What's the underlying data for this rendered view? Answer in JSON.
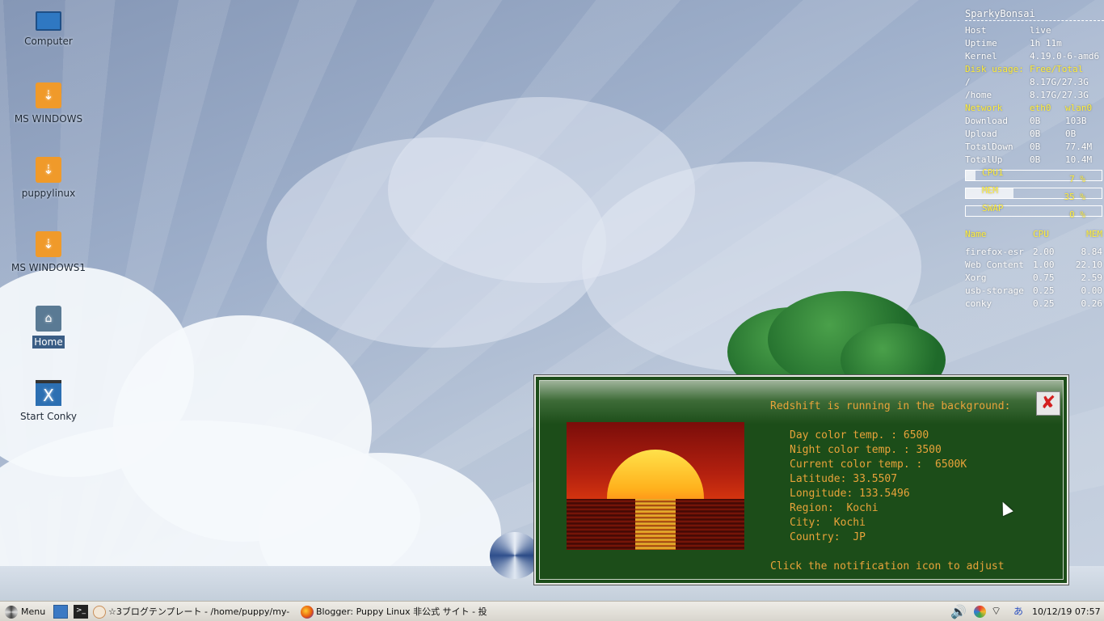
{
  "desktop": {
    "icons": [
      {
        "label": "Computer",
        "icon": "computer-icon"
      },
      {
        "label": "MS WINDOWS",
        "icon": "usb-drive-icon"
      },
      {
        "label": "puppylinux",
        "icon": "usb-drive-icon"
      },
      {
        "label": "MS WINDOWS1",
        "icon": "usb-drive-icon"
      },
      {
        "label": "Home",
        "icon": "home-folder-icon"
      },
      {
        "label": "Start Conky",
        "icon": "conky-icon"
      }
    ]
  },
  "conky": {
    "title": "SparkyBonsai",
    "sys": [
      {
        "k": "Host",
        "v": "live"
      },
      {
        "k": "Uptime",
        "v": "1h 11m"
      },
      {
        "k": "Kernel",
        "v": "4.19.0-6-amd6"
      }
    ],
    "disk_header": {
      "k": "Disk usage:",
      "v": "Free/Total"
    },
    "disk": [
      {
        "k": "/",
        "v": "8.17G/27.3G"
      },
      {
        "k": "/home",
        "v": "8.17G/27.3G"
      }
    ],
    "net_header": {
      "k": "Network",
      "a": "eth0",
      "b": "wlan0"
    },
    "net": [
      {
        "k": "Download",
        "a": "0B",
        "b": "103B"
      },
      {
        "k": "Upload",
        "a": "0B",
        "b": "0B"
      },
      {
        "k": "TotalDown",
        "a": "0B",
        "b": "77.4M"
      },
      {
        "k": "TotalUp",
        "a": "0B",
        "b": "10.4M"
      }
    ],
    "bars": [
      {
        "label": "CPU1",
        "value": "7  %",
        "fraction": 0.07
      },
      {
        "label": "MEM",
        "value": "35 %",
        "fraction": 0.35
      },
      {
        "label": "SWAP",
        "value": "0  %",
        "fraction": 0.0
      }
    ],
    "proc_header": {
      "name": "Name",
      "cpu": "CPU",
      "mem": "MEM"
    },
    "procs": [
      {
        "name": "firefox-esr",
        "cpu": "2.00",
        "mem": "8.84"
      },
      {
        "name": "Web Content",
        "cpu": "1.00",
        "mem": "22.10"
      },
      {
        "name": "Xorg",
        "cpu": "0.75",
        "mem": "2.59"
      },
      {
        "name": "usb-storage",
        "cpu": "0.25",
        "mem": "0.00"
      },
      {
        "name": "conky",
        "cpu": "0.25",
        "mem": "0.26"
      }
    ]
  },
  "dialog": {
    "heading": "Redshift is running in the background:",
    "close_label": "✘",
    "lines": [
      "Day color temp. : 6500",
      "Night color temp. : 3500",
      "Current color temp. :  6500K",
      "Latitude: 33.5507",
      "Longitude: 133.5496",
      "Region:  Kochi",
      "City:  Kochi",
      "Country:  JP"
    ],
    "footer": "Click the notification icon to adjust"
  },
  "taskbar": {
    "menu_label": "Menu",
    "tasks": [
      {
        "label": "☆3ブログテンプレート - /home/puppy/my-",
        "icon": "puppy-icon"
      },
      {
        "label": "Blogger: Puppy Linux 非公式 サイト - 投",
        "icon": "firefox-icon"
      }
    ],
    "ime": "あ",
    "clock": "10/12/19 07:57"
  }
}
